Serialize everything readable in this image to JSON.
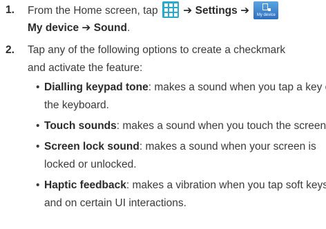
{
  "step1": {
    "number": "1.",
    "prefix": "From the Home screen, tap",
    "apps_icon": "apps-grid-icon",
    "arrow": "➔",
    "settings": "Settings",
    "mydevice_icon_caption": "My device",
    "mydevice": "My device",
    "sound": "Sound",
    "end": "."
  },
  "step2": {
    "number": "2.",
    "line1": "Tap any of the following options to create a checkmark",
    "line2": "and activate the feature:"
  },
  "bullets": [
    {
      "term": "Dialling keypad tone",
      "line1_rest": ": makes a sound when you tap a key on",
      "line2": "the keyboard."
    },
    {
      "term": "Touch sounds",
      "line1_rest": ": makes a sound when you touch the screen.",
      "line2": ""
    },
    {
      "term": "Screen lock sound",
      "line1_rest": ": makes a sound when your screen is",
      "line2": "locked or unlocked."
    },
    {
      "term": "Haptic feedback",
      "line1_rest": ": makes a vibration when you tap soft keys",
      "line2": "and on certain UI interactions."
    }
  ],
  "bullet_char": "•",
  "colors": {
    "apps_icon": "#27a9d2",
    "mydevice_icon": "#2d6ec0",
    "text": "#3a3a3a"
  }
}
